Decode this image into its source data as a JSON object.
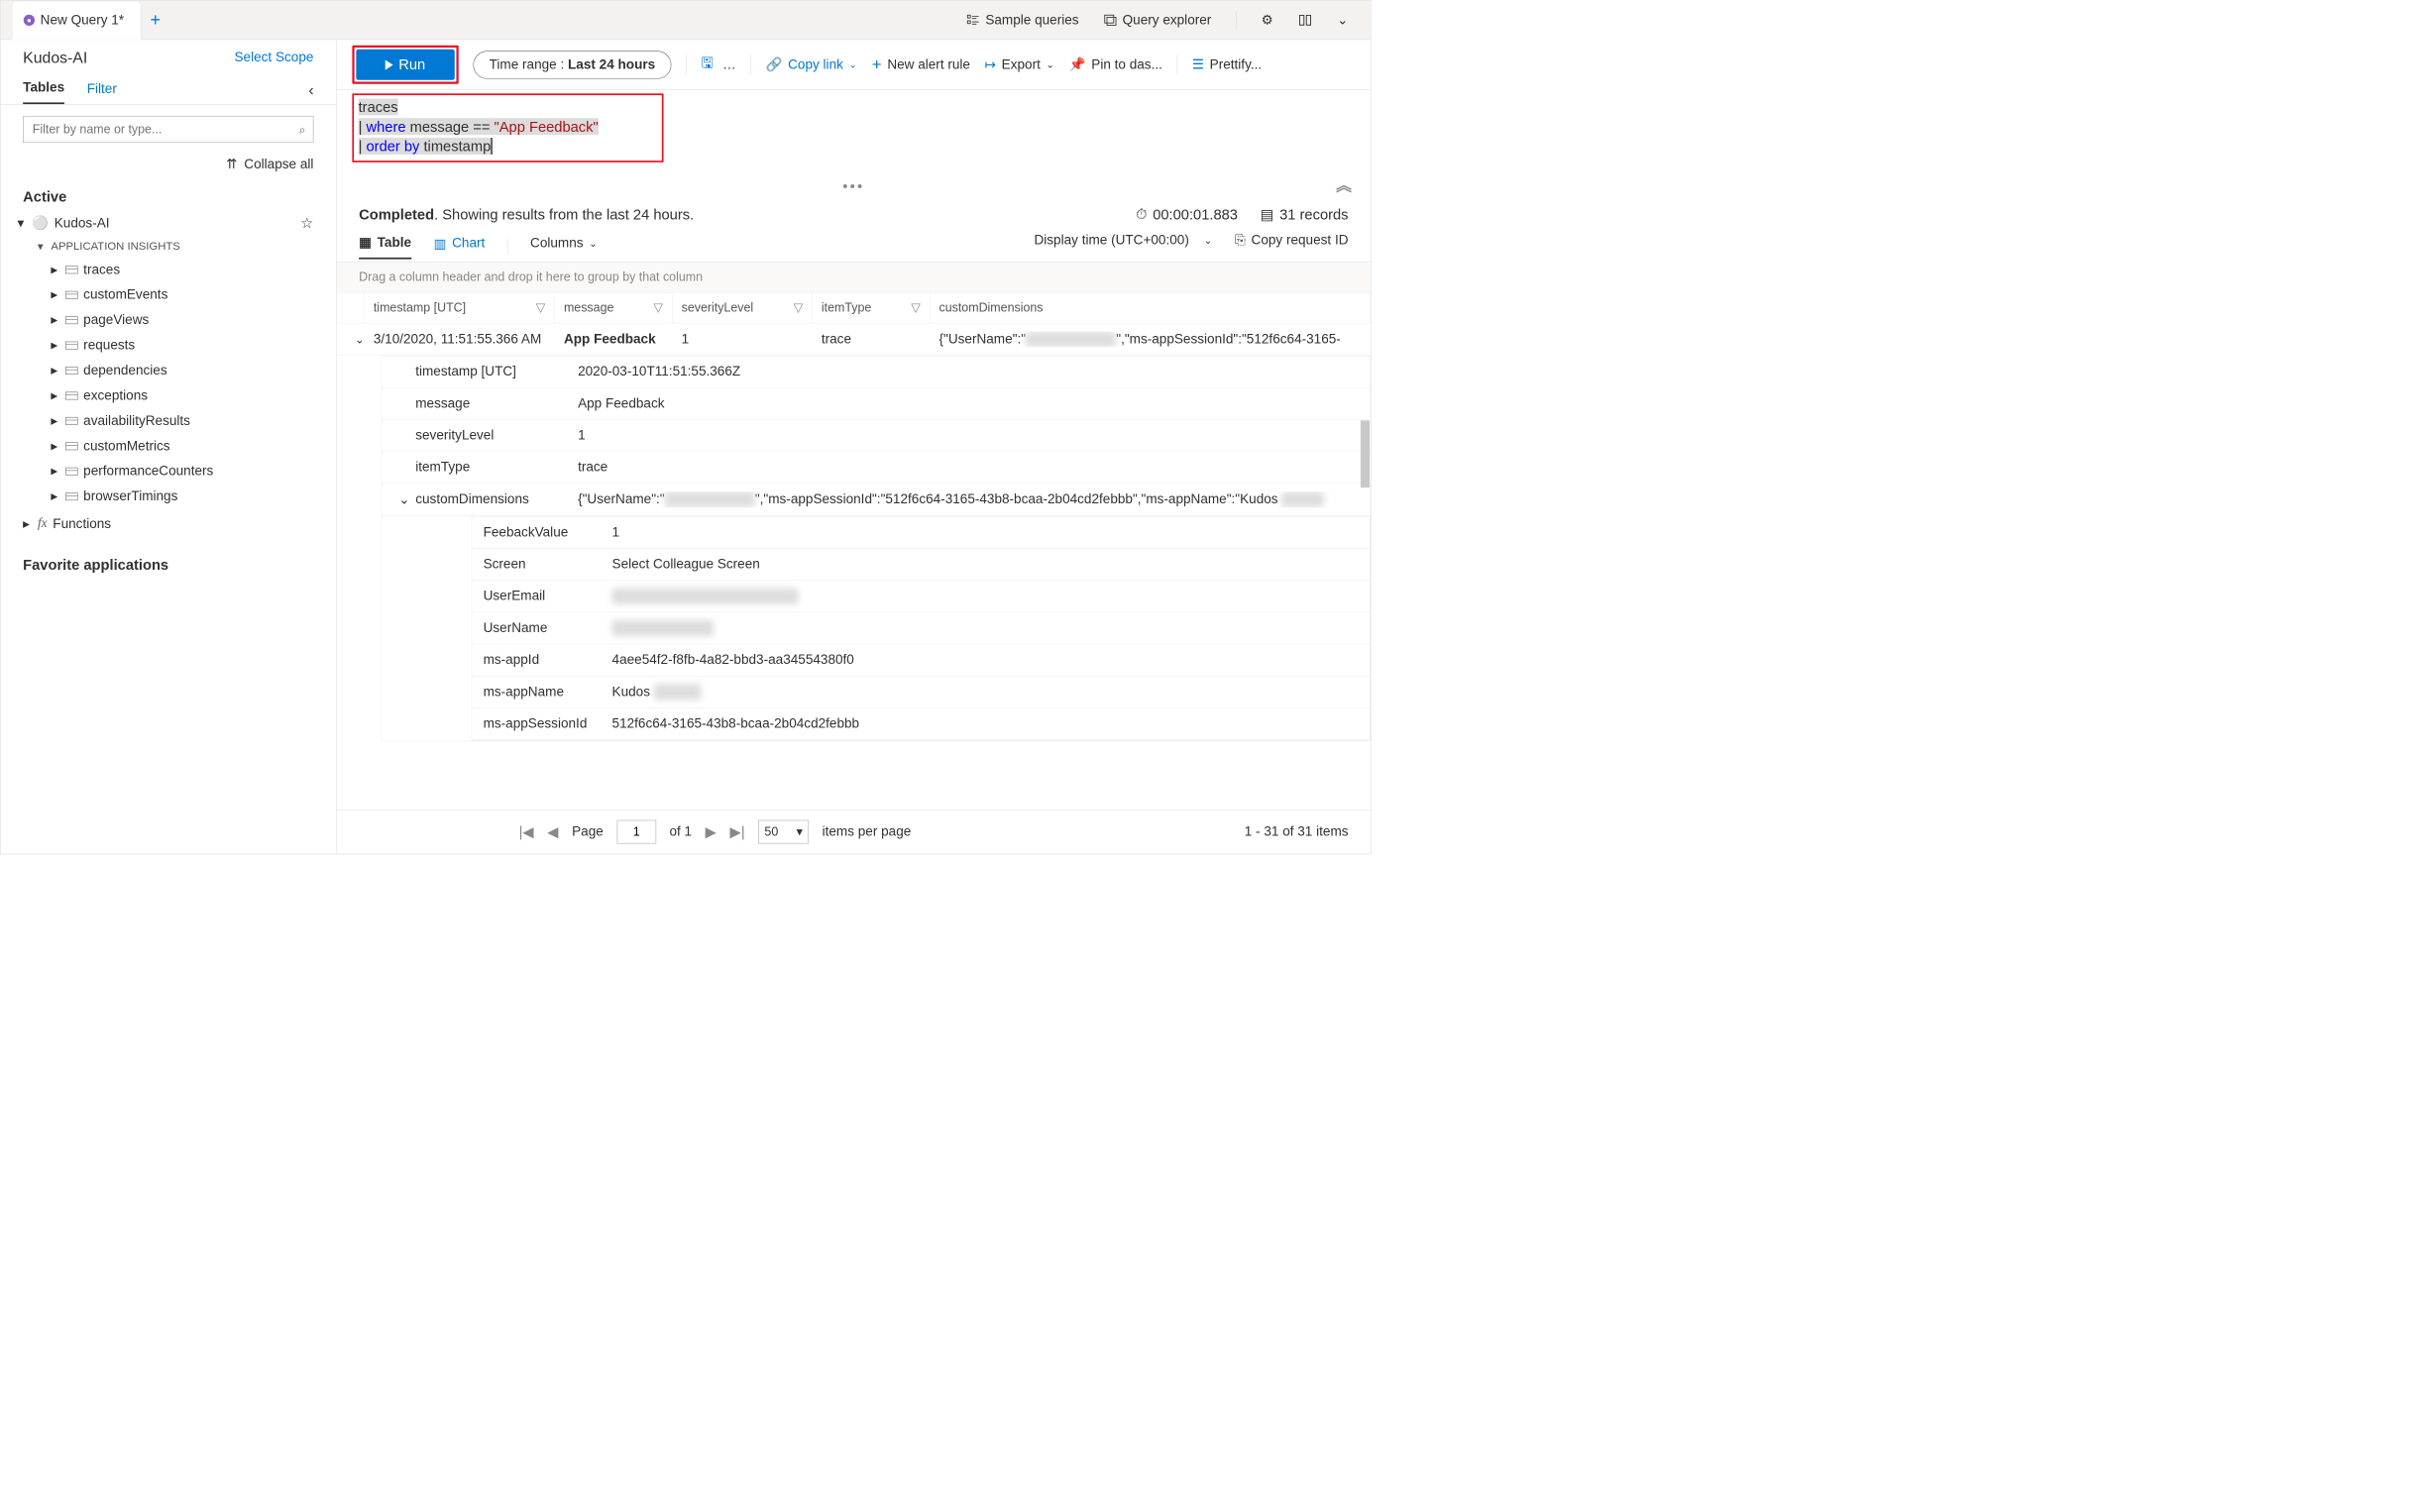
{
  "tabs": {
    "active_name": "New Query 1*"
  },
  "topbar": {
    "sample_queries": "Sample queries",
    "query_explorer": "Query explorer"
  },
  "header": {
    "resource_name": "Kudos-AI",
    "select_scope": "Select Scope"
  },
  "sidebar": {
    "tab_tables": "Tables",
    "tab_filter": "Filter",
    "search_placeholder": "Filter by name or type...",
    "collapse_all": "Collapse all",
    "active_section": "Active",
    "favorite_section": "Favorite applications",
    "resource_node": "Kudos-AI",
    "app_insights_label": "APPLICATION INSIGHTS",
    "tables": [
      "traces",
      "customEvents",
      "pageViews",
      "requests",
      "dependencies",
      "exceptions",
      "availabilityResults",
      "customMetrics",
      "performanceCounters",
      "browserTimings"
    ],
    "functions_label": "Functions"
  },
  "toolbar": {
    "run": "Run",
    "time_prefix": "Time range : ",
    "time_value": "Last 24 hours",
    "copy_link": "Copy link",
    "new_alert": "New alert rule",
    "export": "Export",
    "pin": "Pin to das...",
    "prettify": "Prettify..."
  },
  "query": {
    "line1": "traces",
    "line2_kw1": "where",
    "line2_mid": " message == ",
    "line2_str": "\"App Feedback\"",
    "line3_kw1": "order by",
    "line3_rest": " timestamp"
  },
  "status": {
    "completed": "Completed",
    "sentence_rest": ". Showing results from the last 24 hours.",
    "duration": "00:00:01.883",
    "records": "31 records"
  },
  "views": {
    "table": "Table",
    "chart": "Chart",
    "columns": "Columns",
    "display_time": "Display time (UTC+00:00)",
    "copy_request_id": "Copy request ID"
  },
  "group_hint": "Drag a column header and drop it here to group by that column",
  "columns": {
    "timestamp": "timestamp [UTC]",
    "message": "message",
    "severity": "severityLevel",
    "itemType": "itemType",
    "customDimensions": "customDimensions"
  },
  "row": {
    "timestamp_display": "3/10/2020, 11:51:55.366 AM",
    "message": "App Feedback",
    "severity": "1",
    "itemType": "trace",
    "cd_preview_prefix": "{\"UserName\":\"",
    "cd_preview_suffix": "\",\"ms-appSessionId\":\"512f6c64-3165-"
  },
  "detail": {
    "timestamp_label": "timestamp [UTC]",
    "timestamp_value": "2020-03-10T11:51:55.366Z",
    "message_label": "message",
    "message_value": "App Feedback",
    "severity_label": "severityLevel",
    "severity_value": "1",
    "itemType_label": "itemType",
    "itemType_value": "trace",
    "cd_label": "customDimensions",
    "cd_value_prefix": "{\"UserName\":\"",
    "cd_value_mid": "\",\"ms-appSessionId\":\"512f6c64-3165-43b8-bcaa-2b04cd2febbb\",\"ms-appName\":\"Kudos ",
    "inner": {
      "feedback_k": "FeebackValue",
      "feedback_v": "1",
      "screen_k": "Screen",
      "screen_v": "Select Colleague Screen",
      "email_k": "UserEmail",
      "user_k": "UserName",
      "appid_k": "ms-appId",
      "appid_v": "4aee54f2-f8fb-4a82-bbd3-aa34554380f0",
      "appname_k": "ms-appName",
      "appname_v_prefix": "Kudos ",
      "session_k": "ms-appSessionId",
      "session_v": "512f6c64-3165-43b8-bcaa-2b04cd2febbb"
    }
  },
  "pager": {
    "page_label": "Page",
    "page_num": "1",
    "of": "of 1",
    "size": "50",
    "items_label": "items per page",
    "summary": "1 - 31 of 31 items"
  }
}
